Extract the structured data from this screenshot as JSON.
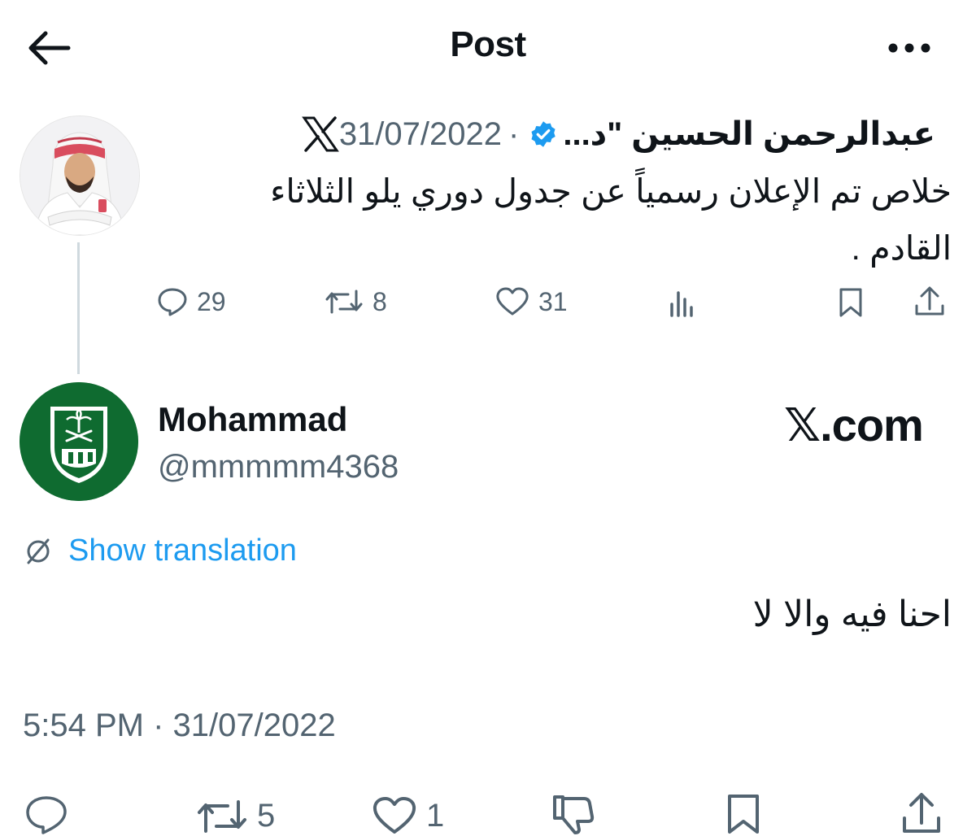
{
  "header": {
    "title": "Post",
    "back_icon": "arrow-left-icon",
    "more_icon": "more-horizontal-icon"
  },
  "original": {
    "author_name": "عبدالرحمن الحسين \"د...",
    "verified_icon": "verified-badge-icon",
    "separator": "·",
    "date": "31/07/2022",
    "platform_icon": "x-logo-icon",
    "text_line1": "خلاص تم الإعلان رسمياً عن جدول دوري يلو الثلاثاء",
    "text_line2": "القادم .",
    "replies": "29",
    "reposts": "8",
    "likes": "31"
  },
  "reply": {
    "author_name": "Mohammad",
    "handle": "@mmmmm4368",
    "watermark": "𝕏.com",
    "translation_link": "Show translation",
    "text": "احنا فيه والا لا",
    "timestamp": "5:54 PM · 31/07/2022",
    "reposts": "5",
    "likes": "1"
  },
  "colors": {
    "accent": "#1d9bf0",
    "muted": "#536471",
    "text": "#0f1419",
    "verified": "#1d9bf0",
    "divider": "#cfd9de"
  }
}
